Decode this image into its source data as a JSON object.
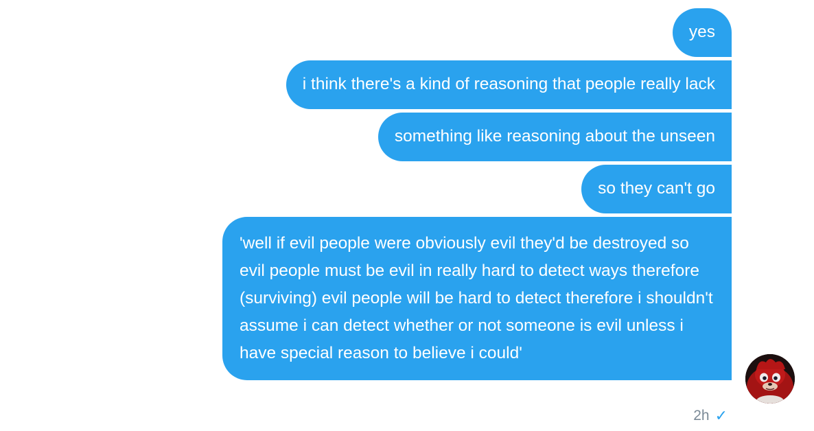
{
  "conversation": {
    "messages": [
      {
        "text": "yes"
      },
      {
        "text": "i think there's a kind of reasoning that people really lack"
      },
      {
        "text": "something like reasoning about the unseen"
      },
      {
        "text": "so they can't go"
      },
      {
        "text": "'well if evil people were obviously evil they'd be destroyed so evil people must be evil in really hard to detect ways therefore (surviving) evil people will be hard to detect therefore i shouldn't assume i can detect whether or not someone is evil unless i have special reason to believe i could'"
      }
    ],
    "timestamp": "2h",
    "read_receipt_icon": "checkmark-icon",
    "bubble_color": "#2aa2ee",
    "meta_color": "#7b8a97"
  }
}
